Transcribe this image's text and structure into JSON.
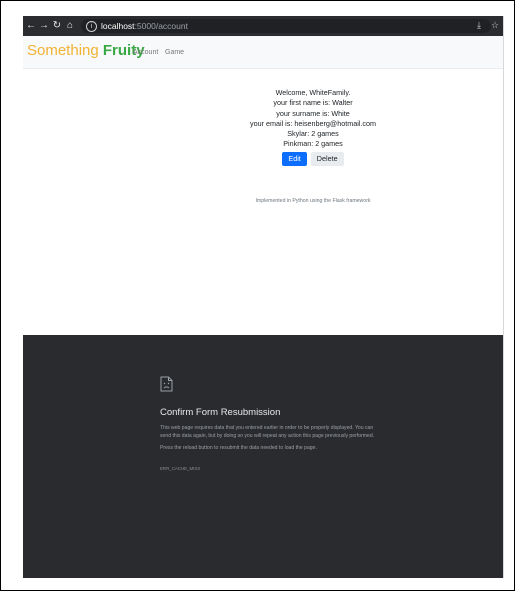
{
  "browser": {
    "url_host": "localhost",
    "url_path": ":5000/account",
    "icons": [
      "back-arrow-icon",
      "forward-arrow-icon",
      "reload-icon",
      "home-icon",
      "info-icon",
      "share-icon",
      "bookmark-star-icon"
    ]
  },
  "navbar": {
    "brand_part1": "Something",
    "brand_part2": "Fruity",
    "links": [
      "Account",
      "Game"
    ],
    "brand_colors": {
      "something": "#f2b233",
      "fruity": "#39a845"
    }
  },
  "account": {
    "welcome": "Welcome, WhiteFamily.",
    "first_name": "your first name is: Walter",
    "surname": "your surname is: White",
    "email": "your email is: heisenberg@hotmail.com",
    "games": [
      "Skylar: 2 games",
      "Pinkman: 2 games"
    ],
    "edit_label": "Edit",
    "delete_label": "Delete"
  },
  "footer": {
    "text": "Implemented in Python using the Flask framework"
  },
  "error": {
    "title": "Confirm Form Resubmission",
    "paragraph1": "This web page requires data that you entered earlier in order to be properly displayed. You can send this data again, but by doing so you will repeat any action this page previously performed.",
    "paragraph2": "Press the reload button to resubmit the data needed to load the page.",
    "code": "ERR_CACHE_MISS"
  },
  "colors": {
    "primary_button": "#0d6efd",
    "error_background": "#2a2b2e",
    "browser_toolbar": "#2b2c30"
  }
}
